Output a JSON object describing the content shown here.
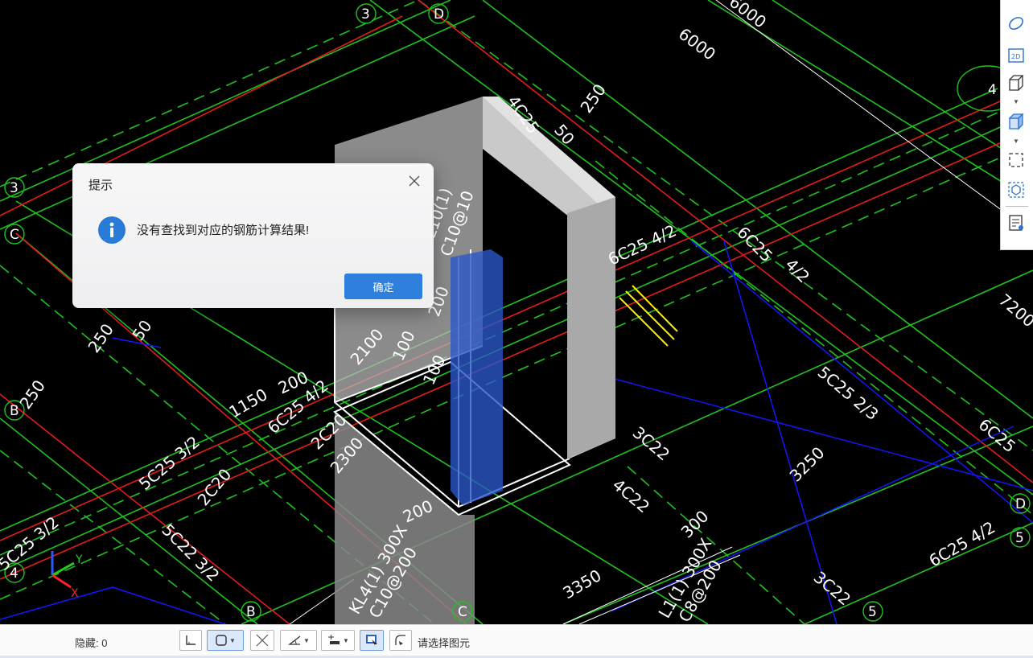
{
  "viewport": {
    "grid_labels": [
      "3",
      "D",
      "3",
      "C",
      "B",
      "4",
      "B",
      "C",
      "D",
      "5",
      "5",
      "4"
    ],
    "dimension_texts": [
      "6000",
      "6000",
      "4C25",
      "50",
      "250",
      "250",
      "50",
      "250",
      "200",
      "1150",
      "2100",
      "200",
      "100",
      "100",
      "200",
      "2300",
      "200",
      "7200",
      "3250",
      "3350",
      "300",
      "3C22",
      "4C22",
      "3C22",
      "2C20",
      "2C20"
    ],
    "rebar_texts": [
      "6C25 4/2",
      "6C25",
      "4/2",
      "5C25 2/3",
      "6C25",
      "5C25 3/2",
      "5C22 3/2",
      "5C25 3/2",
      "6C25 4/2",
      "6C25 4/2",
      "KL10(1)",
      "C10@10"
    ],
    "beam_labels": [
      "KL4(1) 300X",
      "C10@200",
      "L1(1) 300X",
      "C8@200"
    ],
    "axis_triad": {
      "y": "Y",
      "x": "X"
    },
    "colors": {
      "grid_red": "#ff2020",
      "grid_green": "#20d020",
      "beam_blue": "#1010ff",
      "text_white": "#ffffff",
      "annot_yellow": "#ffee00"
    }
  },
  "view_toolbar": {
    "items": [
      {
        "name": "orbit-icon"
      },
      {
        "name": "2d-view-icon",
        "text": "2D"
      },
      {
        "name": "3d-box-icon"
      },
      {
        "name": "3d-solid-box-icon"
      },
      {
        "name": "select-region-icon"
      },
      {
        "name": "cube-select-icon"
      },
      {
        "name": "properties-view-icon"
      }
    ]
  },
  "dialog": {
    "title": "提示",
    "message": "没有查找到对应的钢筋计算结果!",
    "ok_label": "确定"
  },
  "statusbar": {
    "hidden_label": "隐藏: 0",
    "prompt": "请选择图元"
  }
}
